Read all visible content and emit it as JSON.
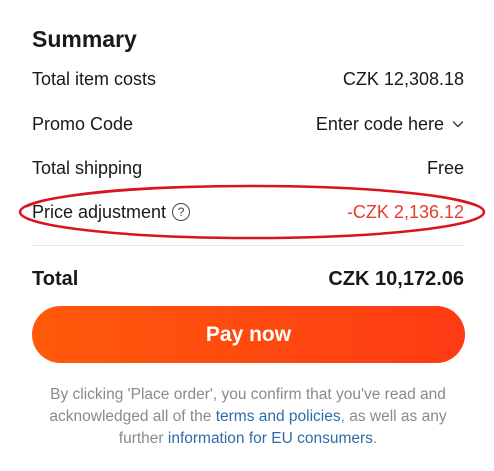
{
  "summary": {
    "title": "Summary",
    "item_costs_label": "Total item costs",
    "item_costs_value": "CZK 12,308.18",
    "promo_label": "Promo Code",
    "promo_value": "Enter code here",
    "shipping_label": "Total shipping",
    "shipping_value": "Free",
    "adjustment_label": "Price adjustment",
    "adjustment_value": "-CZK 2,136.12",
    "total_label": "Total",
    "total_value": "CZK 10,172.06"
  },
  "pay_button": {
    "label": "Pay now"
  },
  "disclaimer": {
    "before": "By clicking 'Place order', you confirm that you've read and acknowledged all of the ",
    "terms_link": "terms and policies",
    "middle": ", as well as any further ",
    "eu_link": "information for EU consumers",
    "after": "."
  },
  "icons": {
    "promo": "chevron-down-icon",
    "adjustment": "help-circle-icon"
  },
  "colors": {
    "discount": "#e83c2f",
    "button_start": "#ff5a0a",
    "button_end": "#ff3a14",
    "annotation": "#d8141c",
    "link": "#2d6ca8"
  }
}
